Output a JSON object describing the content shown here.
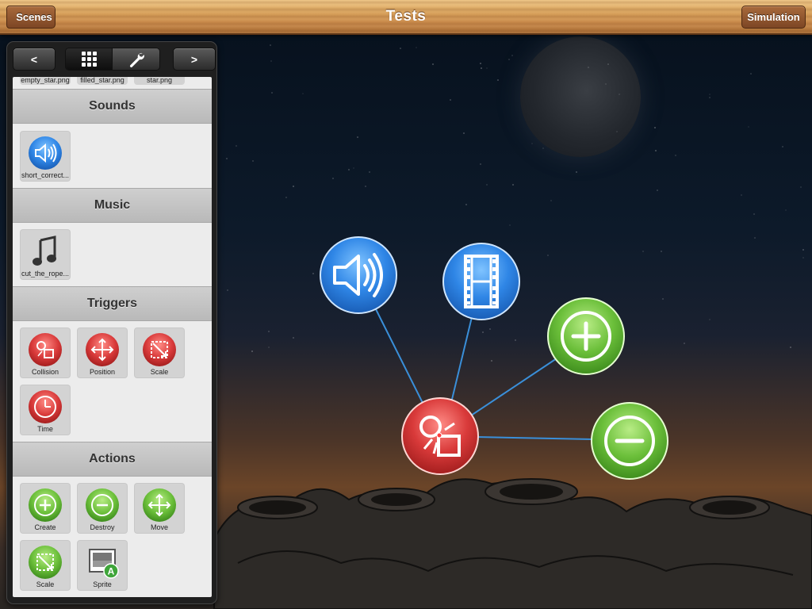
{
  "app": {
    "title": "Tests",
    "scenes_button": "Scenes",
    "simulation_button": "Simulation"
  },
  "panel": {
    "prev_label": "<",
    "next_label": ">",
    "tabs": [
      {
        "icon": "grid-icon",
        "selected": true
      },
      {
        "icon": "wrench-icon",
        "selected": false
      }
    ],
    "partial_items": [
      "empty_star.png",
      "filled_star.png",
      "star.png"
    ],
    "sections": {
      "sounds": {
        "title": "Sounds",
        "items": [
          {
            "label": "short_correct...",
            "icon": "speaker-icon"
          }
        ]
      },
      "music": {
        "title": "Music",
        "items": [
          {
            "label": "cut_the_rope...",
            "icon": "music-note-icon"
          }
        ]
      },
      "triggers": {
        "title": "Triggers",
        "items": [
          {
            "label": "Collision",
            "icon": "collision-icon"
          },
          {
            "label": "Position",
            "icon": "move-arrows-icon"
          },
          {
            "label": "Scale",
            "icon": "scale-icon"
          },
          {
            "label": "Time",
            "icon": "clock-icon"
          }
        ]
      },
      "actions": {
        "title": "Actions",
        "items": [
          {
            "label": "Create",
            "icon": "plus-icon"
          },
          {
            "label": "Destroy",
            "icon": "minus-icon"
          },
          {
            "label": "Move",
            "icon": "move-arrows-icon"
          },
          {
            "label": "Scale",
            "icon": "scale-icon"
          },
          {
            "label": "Sprite",
            "icon": "sprite-icon"
          }
        ]
      }
    }
  },
  "graph": {
    "center_node": {
      "icon": "collision-icon",
      "color": "#d93a3a"
    },
    "connected_nodes": [
      {
        "icon": "speaker-icon",
        "color": "#2f86e6"
      },
      {
        "icon": "film-icon",
        "color": "#2f86e6"
      },
      {
        "icon": "plus-icon",
        "color": "#6bbf3a"
      },
      {
        "icon": "minus-icon",
        "color": "#6bbf3a"
      }
    ],
    "link_color": "#3a8fd9"
  },
  "colors": {
    "trigger_red": "#d93a3a",
    "action_green": "#6bbf3a",
    "sound_blue": "#2f86e6"
  }
}
